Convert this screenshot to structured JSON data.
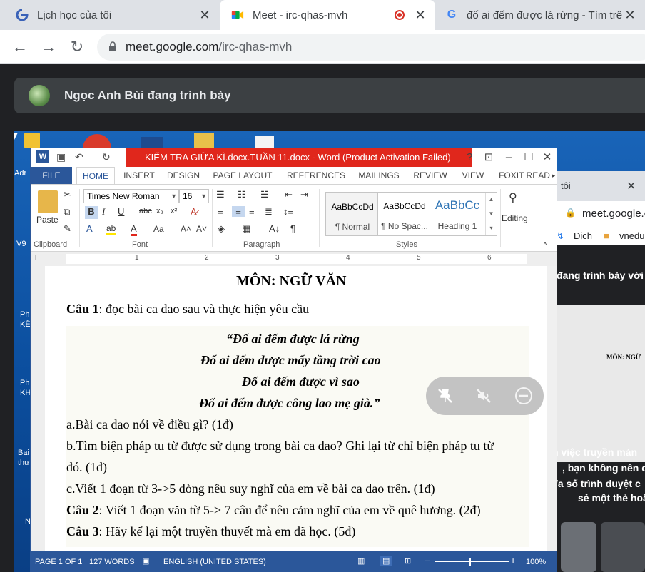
{
  "browser": {
    "tabs": [
      {
        "title": "Lịch học của tôi",
        "icon": "edge-like-icon"
      },
      {
        "title": "Meet - irc-qhas-mvh",
        "icon": "meet-icon",
        "active": true,
        "recording": true
      },
      {
        "title": "đố ai đếm được lá rừng - Tìm trê",
        "icon": "google-icon"
      }
    ],
    "url_host": "meet.google.com",
    "url_path": "/irc-qhas-mvh"
  },
  "meet": {
    "presenter_text": "Ngọc Anh Bùi đang trình bày"
  },
  "desktop_icons": [
    {
      "label": "Adr"
    },
    {
      "label": "V9"
    },
    {
      "label": "Ph KẾ"
    },
    {
      "label": "Ph KH"
    },
    {
      "label": "Bai thư"
    },
    {
      "label": "N"
    }
  ],
  "bg_browser": {
    "tab_title": "tôi",
    "url": "meet.google.c",
    "bookmarks": [
      "Dịch",
      "vnedu"
    ],
    "presenting": "đang trình bày với",
    "warning_lines": [
      "h việc truyền màn",
      ", bạn không nên c",
      "/a sổ trình duyệt c",
      "sẻ một thẻ hoặc n"
    ],
    "doc_thumb_title": "MÔN: NGỮ"
  },
  "word": {
    "title": "KIỂM TRA GIỮA KÌ.docx.TUẦN 11.docx -  Word (Product Activation Failed)",
    "tabs": [
      "FILE",
      "HOME",
      "INSERT",
      "DESIGN",
      "PAGE LAYOUT",
      "REFERENCES",
      "MAILINGS",
      "REVIEW",
      "VIEW",
      "FOXIT READ"
    ],
    "font_name": "Times New Roman",
    "font_size": "16",
    "paste_label": "Paste",
    "styles": [
      {
        "preview": "AaBbCcDd",
        "name": "¶ Normal"
      },
      {
        "preview": "AaBbCcDd",
        "name": "¶ No Spac..."
      },
      {
        "preview": "AaBbCc",
        "name": "Heading 1"
      }
    ],
    "editing_label": "Editing",
    "groups": [
      "Clipboard",
      "Font",
      "Paragraph",
      "Styles"
    ],
    "ruler_marks": [
      "1",
      "2",
      "3",
      "4",
      "5",
      "6"
    ],
    "document": {
      "heading": "MÔN: NGỮ VĂN",
      "q1_label": "Câu 1",
      "q1_text": ": đọc bài ca dao sau và thực hiện yêu cầu",
      "poem": [
        "“Đố ai đếm được lá rừng",
        "Đố ai đếm được mấy tầng trời cao",
        "Đố ai đếm được vì sao",
        "Đố ai đếm được công lao mẹ già.”"
      ],
      "a": "a.Bài ca dao nói về điều gì? (1đ)",
      "b1": "b.Tìm biện pháp tu từ được sử dụng trong bài ca dao? Ghi lại từ chỉ biện pháp tu từ",
      "b2": "đó. (1đ)",
      "c": "c.Viết 1 đoạn từ 3->5 dòng nêu suy nghĩ của em về bài ca dao trên. (1đ)",
      "q2_label": "Câu 2",
      "q2_text": ": Viết 1 đoạn văn từ 5-> 7 câu để nêu cảm nghĩ của em về quê hương. (2đ)",
      "q3_label": "Câu 3",
      "q3_text": ": Hãy kể lại một truyền thuyết mà em đã học. (5đ)"
    },
    "status": {
      "page": "PAGE 1 OF 1",
      "words": "127 WORDS",
      "language": "ENGLISH (UNITED STATES)",
      "zoom": "100%"
    }
  },
  "colors": {
    "word_blue": "#2b579a",
    "title_red": "#e0271c",
    "meet_dark": "#202124"
  }
}
